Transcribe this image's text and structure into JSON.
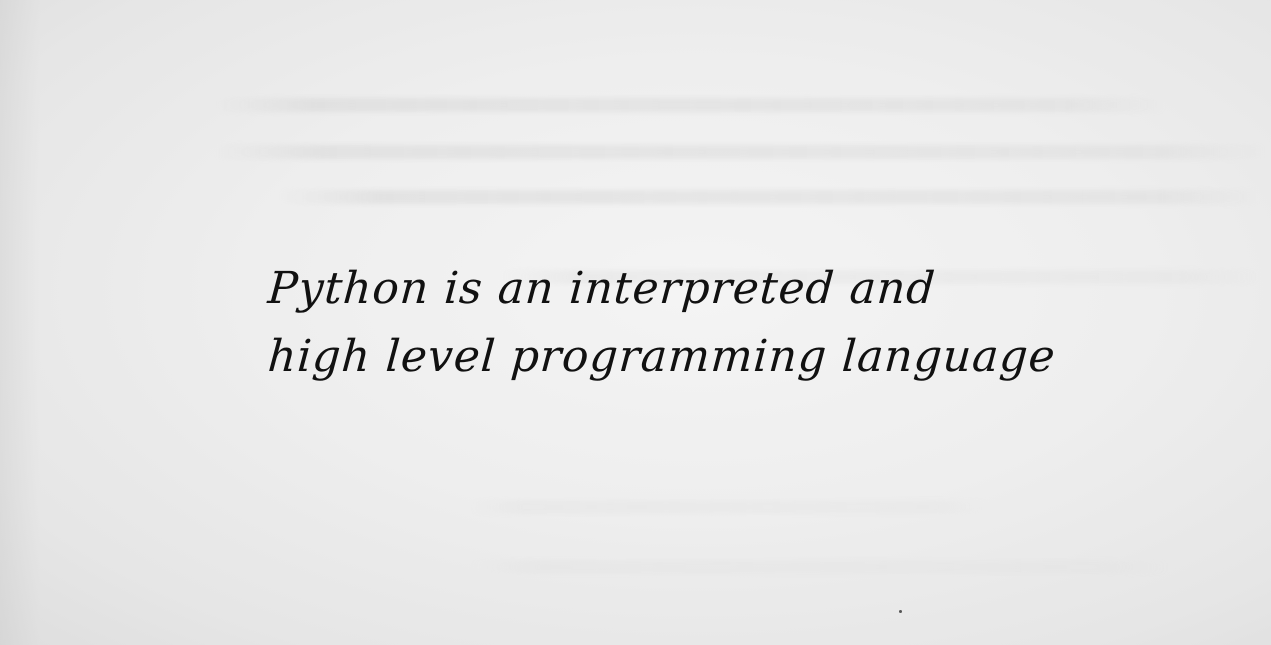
{
  "document": {
    "handwritten_lines": [
      "Python is an interpreted and",
      "high level programming language"
    ]
  },
  "colors": {
    "ink": "#111111",
    "paper": "#eeeeee"
  }
}
